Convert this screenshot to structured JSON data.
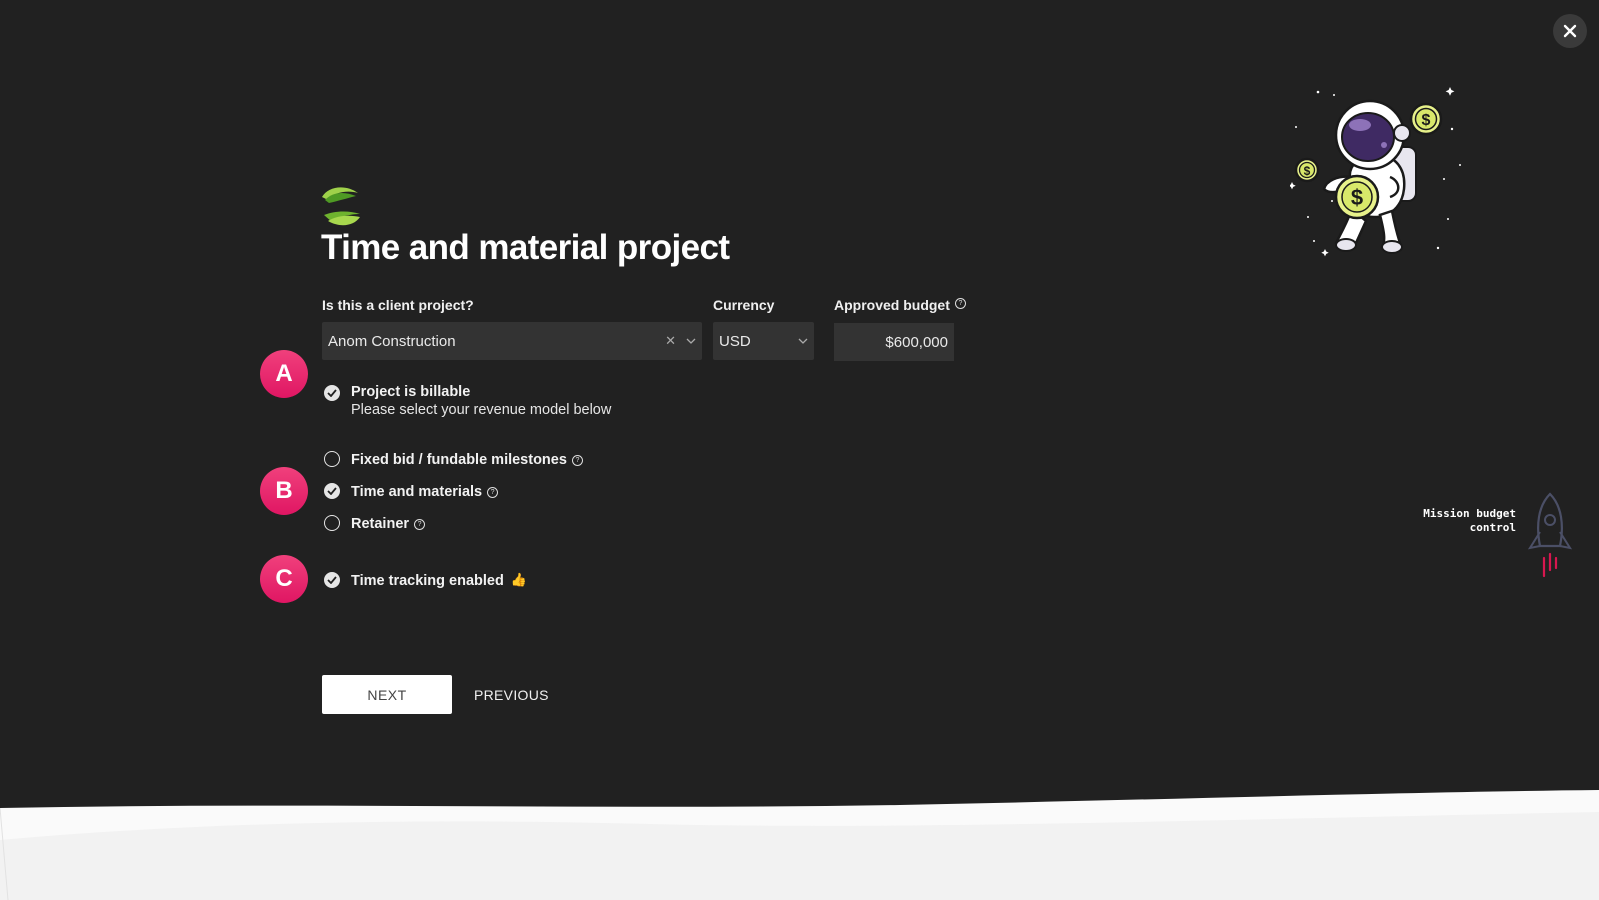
{
  "page": {
    "title": "Time and material project",
    "close_icon": "close-icon"
  },
  "client": {
    "label": "Is this a client project?",
    "value": "Anom Construction"
  },
  "currency": {
    "label": "Currency",
    "value": "USD"
  },
  "budget": {
    "label": "Approved budget",
    "value": "$600,000"
  },
  "steps": {
    "a": "A",
    "b": "B",
    "c": "C"
  },
  "billable": {
    "label": "Project is billable",
    "sub": "Please select your revenue model below",
    "checked": true
  },
  "revenue_models": [
    {
      "label": "Fixed bid / fundable milestones",
      "checked": false
    },
    {
      "label": "Time and materials",
      "checked": true
    },
    {
      "label": "Retainer",
      "checked": false
    }
  ],
  "time_tracking": {
    "label": "Time tracking enabled",
    "emoji": "👍",
    "checked": true
  },
  "buttons": {
    "next": "NEXT",
    "previous": "PREVIOUS"
  },
  "mission": {
    "line1": "Mission budget",
    "line2": "control"
  },
  "colors": {
    "background": "#212121",
    "accent_pink": "#e91e63",
    "logo_green": "#8cc63f",
    "coin_yellow": "#e7f18a"
  }
}
